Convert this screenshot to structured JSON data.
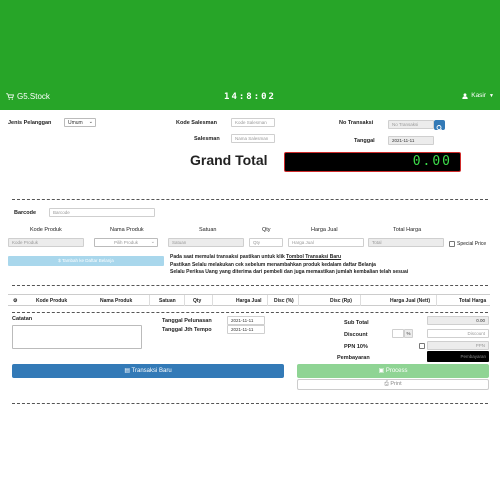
{
  "header": {
    "brand": "G5.Stock",
    "clock": "14:8:02",
    "user": "Kasir"
  },
  "form": {
    "jenis_pelanggan_label": "Jenis Pelanggan",
    "jenis_pelanggan_value": "Umum",
    "kode_salesman_label": "Kode Salesman",
    "kode_salesman_placeholder": "Kode Salesman",
    "salesman_label": "Salesman",
    "salesman_placeholder": "Nama Salesman",
    "no_transaksi_label": "No Transaksi",
    "no_transaksi_placeholder": "No Transaksi",
    "tanggal_label": "Tanggal",
    "tanggal_value": "2021-11-11"
  },
  "grand_total": {
    "label": "Grand Total",
    "value": "0.00"
  },
  "entry": {
    "barcode_label": "Barcode",
    "barcode_placeholder": "Barcode",
    "col_kode": "Kode Produk",
    "col_nama": "Nama Produk",
    "col_satuan": "Satuan",
    "col_qty": "Qty",
    "col_harga": "Harga Jual",
    "col_total": "Total Harga",
    "kode_placeholder": "Kode Produk",
    "nama_placeholder": "Pilih Produk",
    "satuan_placeholder": "Satuan",
    "qty_placeholder": "Qty",
    "harga_placeholder": "Harga Jual",
    "total_placeholder": "Total",
    "special_price_label": "Special Price",
    "add_button": "Tambah ke Daftar Belanja"
  },
  "notes": {
    "line1_pre": "Pada saat memulai transaksi pastikan untuk klik ",
    "line1_link": "Tombol Transaksi Baru",
    "line2": "Pastikan Selalu melakukan cek sebelum menambahkan produk kedalam daftar Belanja",
    "line3": "Selalu Periksa Uang yang diterima dari pembeli dan juga memastikan jumlah kembalian telah sesuai"
  },
  "table": {
    "headers": [
      "Kode Produk",
      "Nama Produk",
      "Satuan",
      "Qty",
      "Harga Jual",
      "Disc (%)",
      "Disc (Rp)",
      "Harga Jual (Nett)",
      "Total Harga"
    ]
  },
  "footer": {
    "catatan_label": "Catatan",
    "tgl_pelunasan_label": "Tanggal Pelunasan",
    "tgl_pelunasan_value": "2021-11-11",
    "tgl_jatuh_tempo_label": "Tanggal Jth Tempo",
    "tgl_jatuh_tempo_value": "2021-11-11",
    "sub_total_label": "Sub Total",
    "sub_total_value": "0.00",
    "discount_label": "Discount",
    "discount_pct_unit": "%",
    "discount_placeholder": "Discount",
    "ppn_label": "PPN 10%",
    "ppn_placeholder": "PPN",
    "pembayaran_label": "Pembayaran",
    "pembayaran_placeholder": "Pembayaran",
    "transaksi_baru_button": "Transaksi Baru",
    "process_button": "Process",
    "print_button": "Print"
  },
  "colors": {
    "header_green": "#27a528",
    "primary_blue": "#337ab7",
    "lcd_digits": "#3ddc4a",
    "lcd_border": "#cf2b2b"
  },
  "icons": [
    "cart-icon",
    "user-icon",
    "caret-down-icon",
    "search-icon",
    "gear-icon",
    "dollar-icon",
    "document-icon",
    "save-icon",
    "print-icon"
  ]
}
